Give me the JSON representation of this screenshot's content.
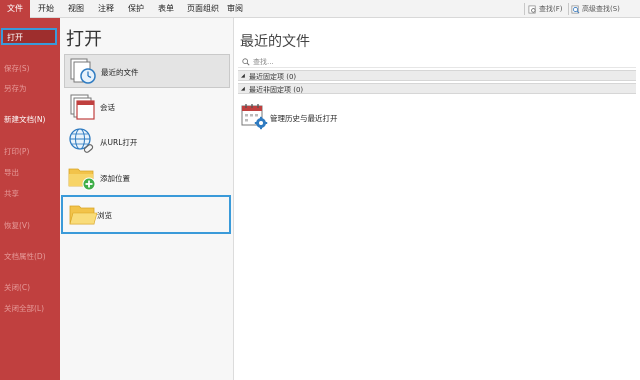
{
  "menubar": {
    "items": [
      "文件",
      "开始",
      "视图",
      "注释",
      "保护",
      "表单",
      "页面组织",
      "审阅"
    ],
    "active_index": 0,
    "find_label": "查找(F)",
    "advanced_find_label": "高级查找(S)"
  },
  "sidebar": {
    "open_label": "打开",
    "items": [
      {
        "label": "保存(S)",
        "enabled": false
      },
      {
        "label": "另存为",
        "enabled": false
      },
      {
        "label": "新建文档(N)",
        "enabled": true
      },
      {
        "label": "打印(P)",
        "enabled": false
      },
      {
        "label": "导出",
        "enabled": false
      },
      {
        "label": "共享",
        "enabled": false
      },
      {
        "label": "恢复(V)",
        "enabled": false
      },
      {
        "label": "文档属性(D)",
        "enabled": false
      },
      {
        "label": "关闭(C)",
        "enabled": false
      },
      {
        "label": "关闭全部(L)",
        "enabled": false
      }
    ]
  },
  "middle": {
    "title": "打开",
    "options": [
      {
        "label": "最近的文件",
        "icon": "recent-files-icon"
      },
      {
        "label": "会话",
        "icon": "session-icon"
      },
      {
        "label": "从URL打开",
        "icon": "globe-link-icon"
      },
      {
        "label": "添加位置",
        "icon": "add-folder-icon"
      },
      {
        "label": "浏览",
        "icon": "folder-open-icon"
      }
    ]
  },
  "right": {
    "title": "最近的文件",
    "search_placeholder": "查找...",
    "groups": [
      "最近固定项 (0)",
      "最近非固定项 (0)"
    ],
    "manage_label": "管理历史与最近打开"
  },
  "colors": {
    "accent_red": "#c0403f",
    "highlight_blue": "#3a9ad9"
  }
}
